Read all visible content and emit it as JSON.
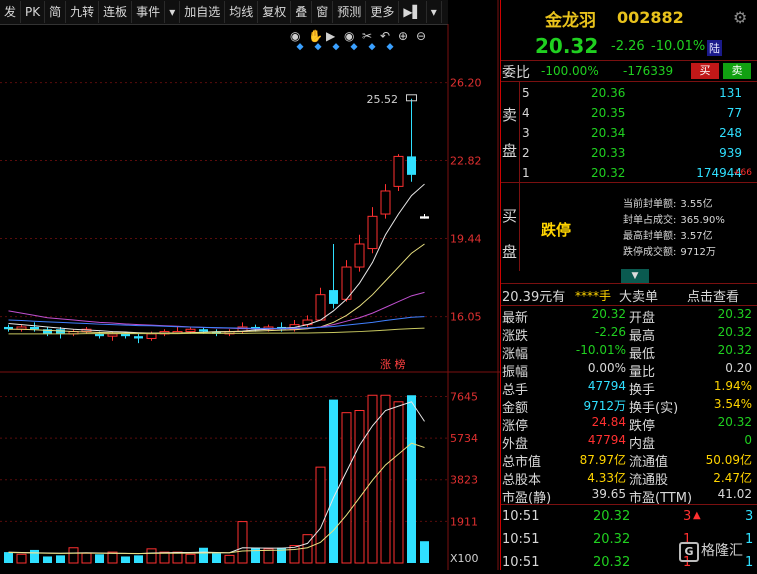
{
  "toolbar": {
    "buttons": [
      "发",
      "PK",
      "简",
      "九转",
      "连板",
      "事件",
      "▾",
      "加自选",
      "均线",
      "复权",
      "叠",
      "窗",
      "预测",
      "更多",
      "▶▌",
      "▾"
    ],
    "icons": [
      "eye-icon",
      "hand-icon",
      "play-icon",
      "camera-icon",
      "scissors-icon",
      "undo-icon",
      "zoom-in-icon",
      "zoom-out-icon"
    ]
  },
  "chart_data": {
    "type": "candlestick",
    "price_axis": [
      "26.20",
      "22.82",
      "19.44",
      "16.05"
    ],
    "price_range": [
      14.6,
      27.4
    ],
    "volume_axis": [
      "7645",
      "5734",
      "3823",
      "1911",
      "X100"
    ],
    "volume_range": [
      0,
      8400
    ],
    "peak_label": "25.52",
    "zt_label": "涨 榜",
    "candles": [
      [
        15.6,
        15.5,
        15.7,
        15.4
      ],
      [
        15.5,
        15.6,
        15.7,
        15.4
      ],
      [
        15.6,
        15.5,
        15.8,
        15.4
      ],
      [
        15.5,
        15.3,
        15.6,
        15.2
      ],
      [
        15.5,
        15.3,
        15.6,
        15.1
      ],
      [
        15.3,
        15.4,
        15.5,
        15.2
      ],
      [
        15.4,
        15.5,
        15.6,
        15.3
      ],
      [
        15.3,
        15.2,
        15.4,
        15.1
      ],
      [
        15.2,
        15.3,
        15.4,
        15.0
      ],
      [
        15.3,
        15.2,
        15.4,
        15.1
      ],
      [
        15.2,
        15.1,
        15.3,
        14.9
      ],
      [
        15.1,
        15.3,
        15.4,
        15.0
      ],
      [
        15.3,
        15.4,
        15.5,
        15.2
      ],
      [
        15.4,
        15.4,
        15.6,
        15.3
      ],
      [
        15.4,
        15.5,
        15.6,
        15.3
      ],
      [
        15.5,
        15.4,
        15.6,
        15.3
      ],
      [
        15.4,
        15.3,
        15.5,
        15.2
      ],
      [
        15.3,
        15.4,
        15.5,
        15.2
      ],
      [
        15.4,
        15.6,
        15.8,
        15.3
      ],
      [
        15.6,
        15.5,
        15.7,
        15.4
      ],
      [
        15.5,
        15.6,
        15.7,
        15.4
      ],
      [
        15.6,
        15.5,
        15.8,
        15.4
      ],
      [
        15.5,
        15.7,
        15.9,
        15.4
      ],
      [
        15.7,
        15.9,
        16.1,
        15.6
      ],
      [
        15.9,
        17.0,
        17.3,
        15.9
      ],
      [
        17.2,
        16.6,
        19.2,
        16.4
      ],
      [
        16.8,
        18.2,
        18.5,
        16.7
      ],
      [
        18.2,
        19.2,
        19.6,
        18.0
      ],
      [
        19.0,
        20.4,
        20.8,
        18.8
      ],
      [
        20.5,
        21.5,
        21.8,
        20.3
      ],
      [
        21.7,
        23.0,
        23.1,
        21.5
      ],
      [
        23.0,
        22.2,
        25.5,
        21.9
      ],
      [
        20.4,
        20.3,
        20.5,
        20.3
      ]
    ],
    "volumes": [
      500,
      400,
      600,
      300,
      350,
      700,
      450,
      400,
      500,
      300,
      350,
      650,
      500,
      500,
      400,
      700,
      450,
      350,
      1900,
      700,
      650,
      700,
      800,
      1300,
      4400,
      7500,
      6900,
      7000,
      7700,
      7700,
      7400,
      7700,
      1000
    ],
    "ma_price": {
      "white": [
        15.75,
        15.7,
        15.65,
        15.6,
        15.55,
        15.5,
        15.47,
        15.44,
        15.4,
        15.38,
        15.35,
        15.33,
        15.33,
        15.33,
        15.35,
        15.37,
        15.4,
        15.4,
        15.42,
        15.47,
        15.5,
        15.55,
        15.58,
        15.7,
        15.9,
        16.3,
        16.8,
        17.5,
        18.4,
        19.6,
        20.5,
        21.3,
        21.8
      ],
      "yellow": [
        15.5,
        15.5,
        15.48,
        15.45,
        15.43,
        15.4,
        15.38,
        15.36,
        15.35,
        15.34,
        15.33,
        15.33,
        15.33,
        15.34,
        15.35,
        15.36,
        15.38,
        15.39,
        15.4,
        15.42,
        15.44,
        15.46,
        15.48,
        15.52,
        15.6,
        15.8,
        16.1,
        16.5,
        17.0,
        17.6,
        18.2,
        18.8,
        19.2
      ],
      "magenta": [
        16.3,
        16.2,
        16.1,
        16.0,
        15.95,
        15.9,
        15.85,
        15.8,
        15.77,
        15.73,
        15.7,
        15.68,
        15.65,
        15.63,
        15.6,
        15.58,
        15.56,
        15.55,
        15.53,
        15.52,
        15.52,
        15.52,
        15.53,
        15.55,
        15.6,
        15.7,
        15.85,
        16.0,
        16.2,
        16.45,
        16.7,
        16.95,
        17.1
      ],
      "blue": [
        15.9,
        15.88,
        15.85,
        15.82,
        15.8,
        15.77,
        15.75,
        15.72,
        15.7,
        15.68,
        15.66,
        15.65,
        15.63,
        15.61,
        15.6,
        15.58,
        15.57,
        15.56,
        15.55,
        15.54,
        15.54,
        15.54,
        15.55,
        15.56,
        15.58,
        15.62,
        15.68,
        15.74,
        15.8,
        15.88,
        15.95,
        16.02,
        16.05
      ],
      "olive": [
        15.3,
        15.3,
        15.3,
        15.3,
        15.3,
        15.3,
        15.31,
        15.31,
        15.31,
        15.31,
        15.31,
        15.31,
        15.31,
        15.31,
        15.32,
        15.32,
        15.32,
        15.32,
        15.32,
        15.33,
        15.33,
        15.33,
        15.34,
        15.34,
        15.35,
        15.36,
        15.38,
        15.4,
        15.43,
        15.46,
        15.5,
        15.53,
        15.55
      ]
    },
    "ma_vol": {
      "white": [
        500,
        480,
        470,
        460,
        450,
        460,
        470,
        460,
        450,
        440,
        430,
        460,
        470,
        480,
        480,
        500,
        480,
        470,
        700,
        690,
        680,
        680,
        720,
        900,
        1600,
        3000,
        4200,
        5400,
        6300,
        7000,
        7200,
        7400,
        6500
      ],
      "yellow": [
        480,
        470,
        460,
        450,
        440,
        450,
        455,
        450,
        445,
        440,
        435,
        440,
        445,
        450,
        455,
        460,
        465,
        470,
        550,
        570,
        580,
        590,
        620,
        700,
        950,
        1500,
        2200,
        3000,
        3800,
        4500,
        5000,
        5500,
        5300
      ]
    }
  },
  "quote": {
    "name": "金龙羽",
    "code": "002882",
    "price": "20.32",
    "change": "-2.26",
    "pct": "-10.01%",
    "badge": "陆",
    "webi_label": "委比",
    "webi_pct": "-100.00%",
    "webi_diff": "-176339",
    "buy_btn": "买",
    "sell_btn": "卖"
  },
  "sell_side": {
    "label_a": "卖",
    "label_b": "盘",
    "levels": [
      {
        "n": "5",
        "price": "20.36",
        "vol": "131",
        "extra": ""
      },
      {
        "n": "4",
        "price": "20.35",
        "vol": "77",
        "extra": ""
      },
      {
        "n": "3",
        "price": "20.34",
        "vol": "248",
        "extra": ""
      },
      {
        "n": "2",
        "price": "20.33",
        "vol": "939",
        "extra": ""
      },
      {
        "n": "1",
        "price": "20.32",
        "vol": "174944",
        "extra": "+66"
      }
    ]
  },
  "buy_side": {
    "label_a": "买",
    "label_b": "盘",
    "status": "跌停",
    "stats": [
      {
        "k": "当前封单额:",
        "v": "3.55亿"
      },
      {
        "k": "封单占成交:",
        "v": "365.90%"
      },
      {
        "k": "最高封单额:",
        "v": "3.57亿"
      },
      {
        "k": "跌停成交额:",
        "v": "9712万"
      }
    ]
  },
  "trade_bar": {
    "price": "20.39元有",
    "hidden": "****手",
    "big": "大卖单",
    "action": "点击查看"
  },
  "stats_rows": [
    {
      "k1": "最新",
      "v1": "20.32",
      "c1": "g",
      "k2": "开盘",
      "v2": "20.32",
      "c2": "g"
    },
    {
      "k1": "涨跌",
      "v1": "-2.26",
      "c1": "g",
      "k2": "最高",
      "v2": "20.32",
      "c2": "g"
    },
    {
      "k1": "涨幅",
      "v1": "-10.01%",
      "c1": "g",
      "k2": "最低",
      "v2": "20.32",
      "c2": "g"
    },
    {
      "k1": "振幅",
      "v1": "0.00%",
      "c1": "w",
      "k2": "量比",
      "v2": "0.20",
      "c2": "w"
    },
    {
      "k1": "总手",
      "v1": "47794",
      "c1": "c",
      "k2": "换手",
      "v2": "1.94%",
      "c2": "y"
    },
    {
      "k1": "金额",
      "v1": "9712万",
      "c1": "c",
      "k2": "换手(实)",
      "v2": "3.54%",
      "c2": "y"
    },
    {
      "k1": "涨停",
      "v1": "24.84",
      "c1": "r",
      "k2": "跌停",
      "v2": "20.32",
      "c2": "g"
    },
    {
      "k1": "外盘",
      "v1": "47794",
      "c1": "r",
      "k2": "内盘",
      "v2": "0",
      "c2": "g"
    },
    {
      "k1": "总市值",
      "v1": "87.97亿",
      "c1": "y",
      "k2": "流通值",
      "v2": "50.09亿",
      "c2": "y"
    },
    {
      "k1": "总股本",
      "v1": "4.33亿",
      "c1": "y",
      "k2": "流通股",
      "v2": "2.47亿",
      "c2": "y"
    },
    {
      "k1": "市盈(静)",
      "v1": "39.65",
      "c1": "w",
      "k2": "市盈(TTM)",
      "v2": "41.02",
      "c2": "w"
    }
  ],
  "ticks": [
    {
      "t": "10:51",
      "p": "20.32",
      "v": "3",
      "arrow": "▲",
      "n": "3"
    },
    {
      "t": "10:51",
      "p": "20.32",
      "v": "1",
      "arrow": "",
      "n": "1"
    },
    {
      "t": "10:51",
      "p": "20.32",
      "v": "1",
      "arrow": "",
      "n": "1"
    }
  ],
  "watermark": "格隆汇",
  "colors": {
    "up": "#ff3030",
    "down": "#20d020",
    "cyan": "#30e0ff",
    "yellow": "#ffd400",
    "grid": "#7a1010"
  }
}
